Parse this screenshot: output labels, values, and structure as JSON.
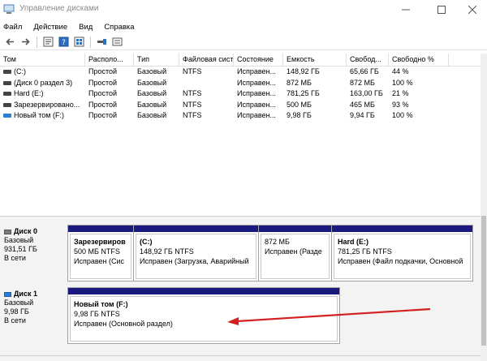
{
  "window": {
    "title": "Управление дисками"
  },
  "menu": [
    {
      "label": "Файл"
    },
    {
      "label": "Действие"
    },
    {
      "label": "Вид"
    },
    {
      "label": "Справка"
    }
  ],
  "table": {
    "columns": [
      {
        "label": "Том"
      },
      {
        "label": "Располо..."
      },
      {
        "label": "Тип"
      },
      {
        "label": "Файловая система"
      },
      {
        "label": "Состояние"
      },
      {
        "label": "Емкость"
      },
      {
        "label": "Свобод..."
      },
      {
        "label": "Свободно %"
      }
    ],
    "rows": [
      {
        "icon_color": "#444444",
        "cells": [
          "(C:)",
          "Простой",
          "Базовый",
          "NTFS",
          "Исправен...",
          "148,92 ГБ",
          "65,66 ГБ",
          "44 %"
        ]
      },
      {
        "icon_color": "#444444",
        "cells": [
          "(Диск 0 раздел 3)",
          "Простой",
          "Базовый",
          "",
          "Исправен...",
          "872 МБ",
          "872 МБ",
          "100 %"
        ]
      },
      {
        "icon_color": "#444444",
        "cells": [
          "Hard (E:)",
          "Простой",
          "Базовый",
          "NTFS",
          "Исправен...",
          "781,25 ГБ",
          "163,00 ГБ",
          "21 %"
        ]
      },
      {
        "icon_color": "#444444",
        "cells": [
          "Зарезервировано...",
          "Простой",
          "Базовый",
          "NTFS",
          "Исправен...",
          "500 МБ",
          "465 МБ",
          "93 %"
        ]
      },
      {
        "icon_color": "#2a7fd4",
        "cells": [
          "Новый том (F:)",
          "Простой",
          "Базовый",
          "NTFS",
          "Исправен...",
          "9,98 ГБ",
          "9,94 ГБ",
          "100 %"
        ]
      }
    ]
  },
  "disks": [
    {
      "name": "Диск 0",
      "type": "Базовый",
      "size": "931,51 ГБ",
      "status": "В сети",
      "partitions": [
        {
          "name": "Зарезервиров",
          "info": "500 МБ NTFS",
          "status": "Исправен (Сис"
        },
        {
          "name": "(C:)",
          "info": "148,92 ГБ NTFS",
          "status": "Исправен (Загрузка, Аварийный"
        },
        {
          "name": "",
          "info": "872 МБ",
          "status": "Исправен (Разде"
        },
        {
          "name": "Hard  (E:)",
          "info": "781,25 ГБ NTFS",
          "status": "Исправен (Файл подкачки, Основной"
        }
      ]
    },
    {
      "name": "Диск 1",
      "type": "Базовый",
      "size": "9,98 ГБ",
      "status": "В сети",
      "partitions": [
        {
          "name": "Новый том  (F:)",
          "info": "9,98 ГБ NTFS",
          "status": "Исправен (Основной раздел)"
        }
      ]
    }
  ],
  "colors": {
    "partition_header": "#1a1a7e",
    "annotation_arrow": "#d42020"
  }
}
